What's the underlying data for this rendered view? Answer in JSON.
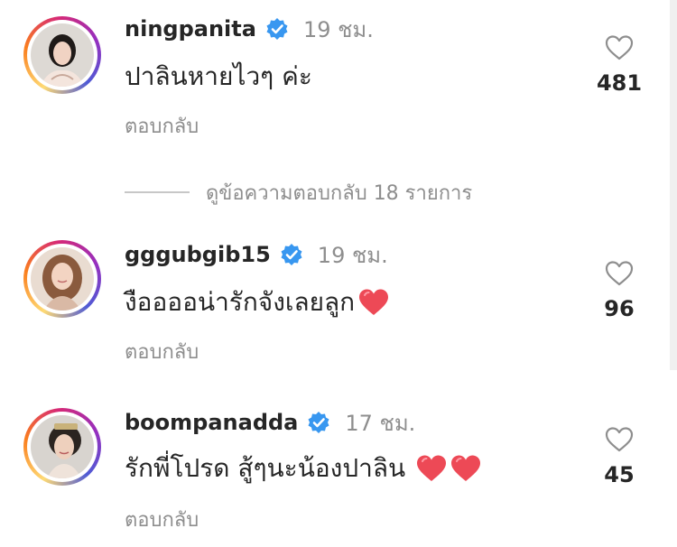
{
  "comments": [
    {
      "username": "ningpanita",
      "time": "19 ชม.",
      "text": "ปาลินหายไวๆ ค่ะ",
      "reply_label": "ตอบกลับ",
      "likes": "481",
      "verified": true
    },
    {
      "username": "gggubgib15",
      "time": "19 ชม.",
      "text": "งืออออน่ารักจังเลยลูก",
      "reply_label": "ตอบกลับ",
      "likes": "96",
      "verified": true
    },
    {
      "username": "boompanadda",
      "time": "17 ชม.",
      "text": "รักพี่โปรด  สู้ๆนะน้องปาลิน",
      "reply_label": "ตอบกลับ",
      "likes": "45",
      "verified": true
    }
  ],
  "view_replies": {
    "label": "ดูข้อความตอบกลับ 18 รายการ"
  },
  "colors": {
    "text_primary": "#262626",
    "text_secondary": "#8e8e8e",
    "verified_blue": "#3897f0",
    "heart_red": "#ed4956"
  },
  "icons": {
    "verified": "verified-badge-icon",
    "like": "heart-outline-icon",
    "emoji": "red-heart-emoji-icon"
  }
}
